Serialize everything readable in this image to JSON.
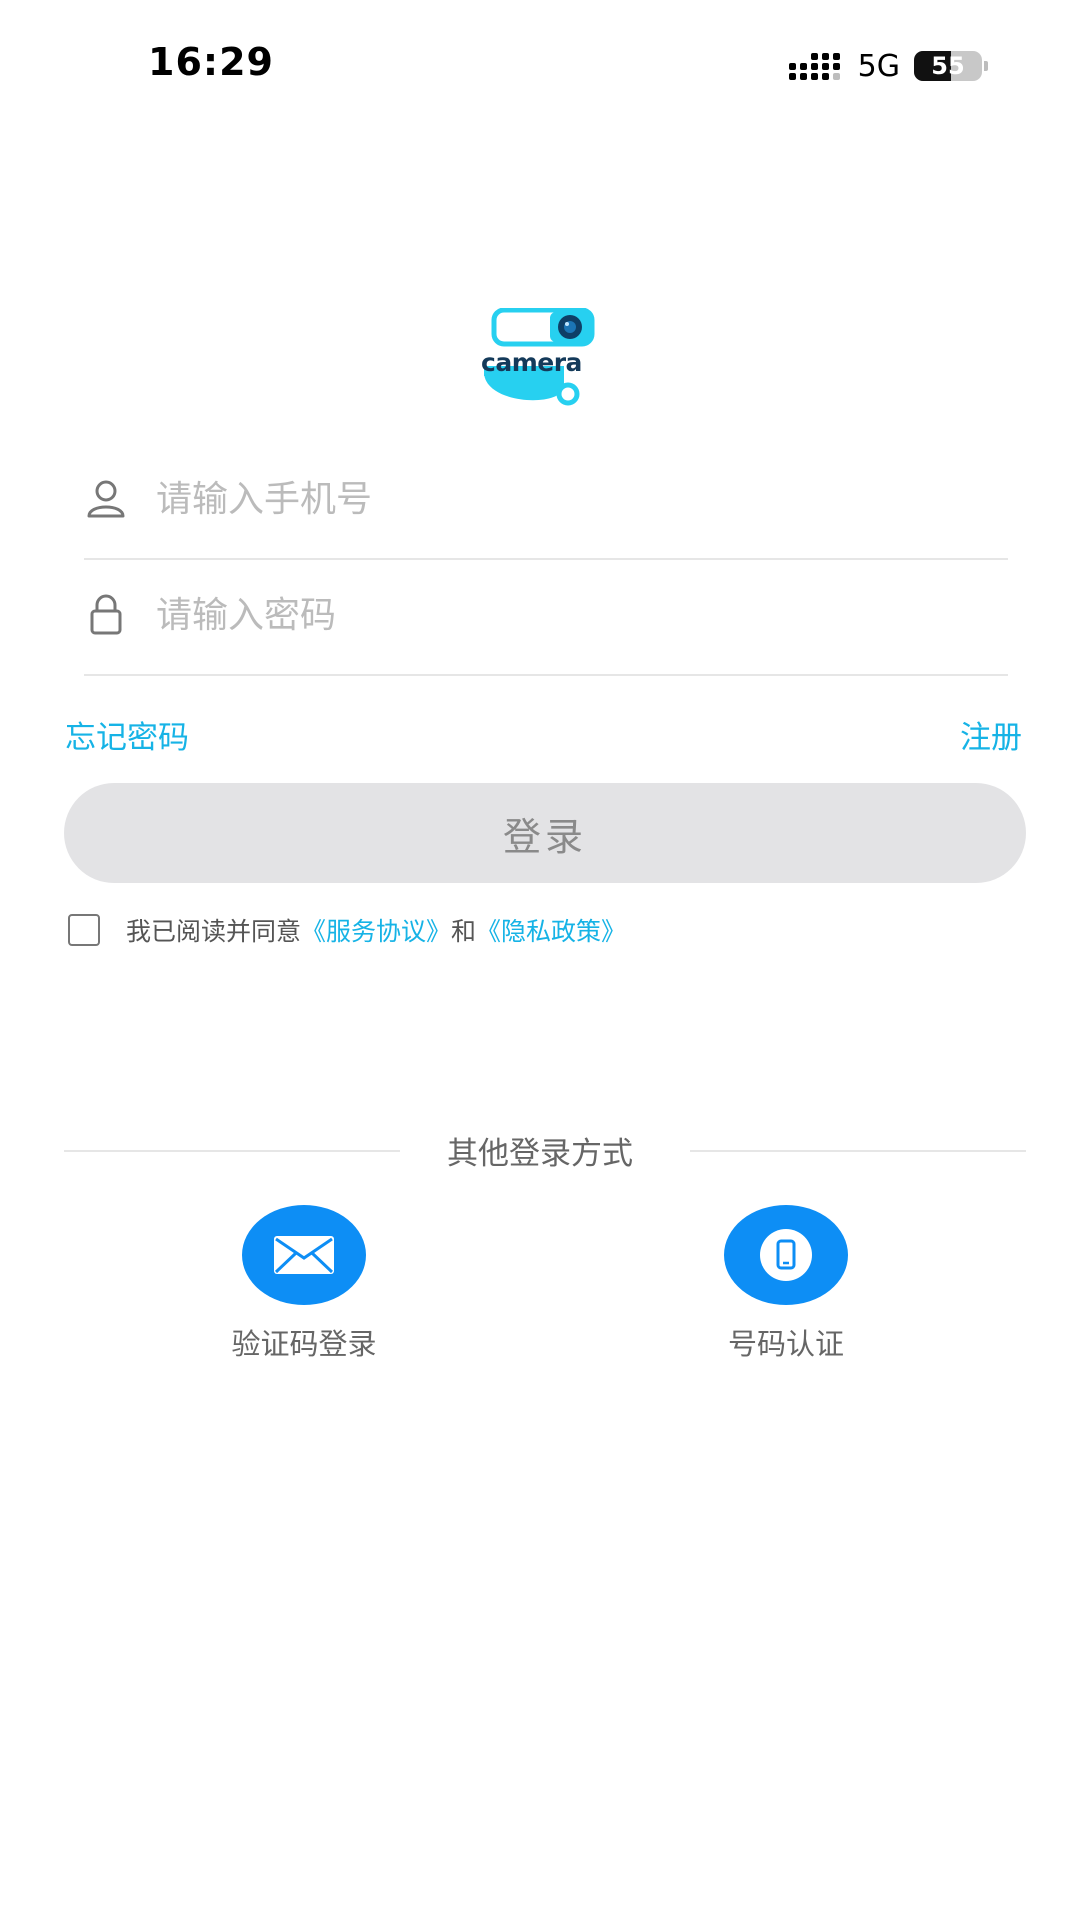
{
  "status_bar": {
    "time": "16:29",
    "network": "5G",
    "battery_level": "55",
    "battery_percent": 55
  },
  "logo": {
    "wordmark": "camera",
    "colors": {
      "accent": "#27d0f0",
      "text": "#143a5a"
    }
  },
  "form": {
    "phone_placeholder": "请输入手机号",
    "password_placeholder": "请输入密码",
    "forgot_password": "忘记密码",
    "register": "注册",
    "login_button": "登录"
  },
  "agreement": {
    "prefix": "我已阅读并同意",
    "service_link": "《服务协议》",
    "conjunction": "和",
    "privacy_link": "《隐私政策》",
    "checked": false
  },
  "other_login": {
    "title": "其他登录方式",
    "options": [
      {
        "label": "验证码登录",
        "icon": "envelope-icon"
      },
      {
        "label": "号码认证",
        "icon": "phone-icon"
      }
    ]
  },
  "colors": {
    "link": "#16b3e6",
    "primary_icon_bg": "#0d8ef5",
    "disabled_button_bg": "#e3e3e5"
  }
}
